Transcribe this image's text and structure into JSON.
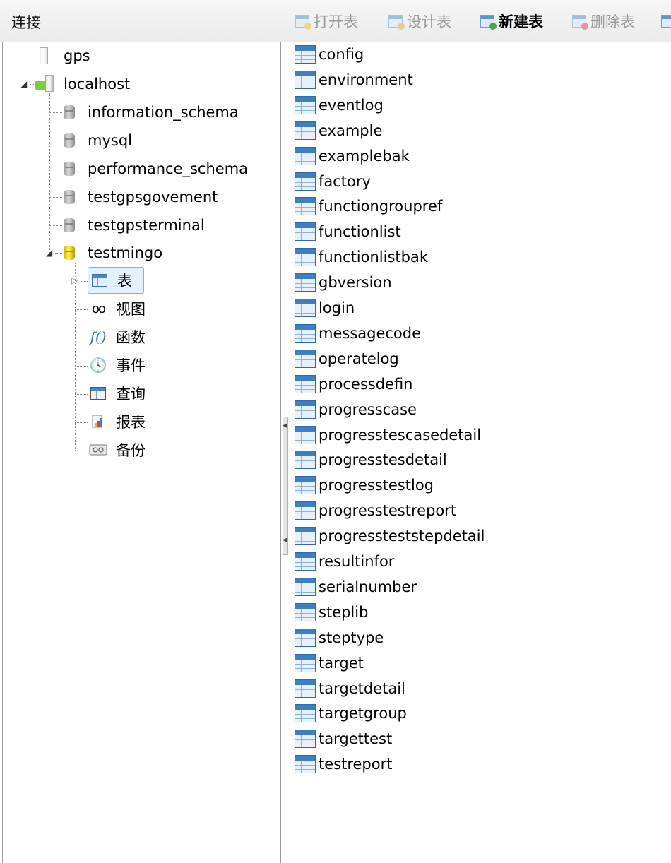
{
  "left_header": {
    "title": "连接"
  },
  "toolbar": {
    "buttons": [
      {
        "label": "打开表",
        "icon": "open-table-icon",
        "enabled": false
      },
      {
        "label": "设计表",
        "icon": "design-table-icon",
        "enabled": false
      },
      {
        "label": "新建表",
        "icon": "new-table-icon",
        "enabled": true
      },
      {
        "label": "删除表",
        "icon": "delete-table-icon",
        "enabled": false
      }
    ]
  },
  "tree": {
    "connections": [
      {
        "label": "gps",
        "icon": "server-icon",
        "expanded": false
      },
      {
        "label": "localhost",
        "icon": "connected-server-icon",
        "expanded": true
      }
    ],
    "databases": [
      {
        "label": "information_schema",
        "open": false
      },
      {
        "label": "mysql",
        "open": false
      },
      {
        "label": "performance_schema",
        "open": false
      },
      {
        "label": "testgpsgovement",
        "open": false
      },
      {
        "label": "testgpsterminal",
        "open": false
      },
      {
        "label": "testmingo",
        "open": true
      }
    ],
    "objects": [
      {
        "label": "表",
        "icon": "table-icon",
        "selected": true
      },
      {
        "label": "视图",
        "icon": "view-glasses-icon"
      },
      {
        "label": "函数",
        "icon": "function-icon",
        "glyph": "f()"
      },
      {
        "label": "事件",
        "icon": "event-clock-icon"
      },
      {
        "label": "查询",
        "icon": "query-icon"
      },
      {
        "label": "报表",
        "icon": "report-icon"
      },
      {
        "label": "备份",
        "icon": "backup-icon"
      }
    ]
  },
  "tables": [
    "config",
    "environment",
    "eventlog",
    "example",
    "examplebak",
    "factory",
    "functiongroupref",
    "functionlist",
    "functionlistbak",
    "gbversion",
    "login",
    "messagecode",
    "operatelog",
    "processdefin",
    "progresscase",
    "progresstescasedetail",
    "progresstesdetail",
    "progresstestlog",
    "progresstestreport",
    "progressteststepdetail",
    "resultinfor",
    "serialnumber",
    "steplib",
    "steptype",
    "target",
    "targetdetail",
    "targetgroup",
    "targettest",
    "testreport"
  ],
  "colors": {
    "accent": "#3b7fc4",
    "selection": "#e3f0fd",
    "disabled_text": "#9a9a9a"
  }
}
